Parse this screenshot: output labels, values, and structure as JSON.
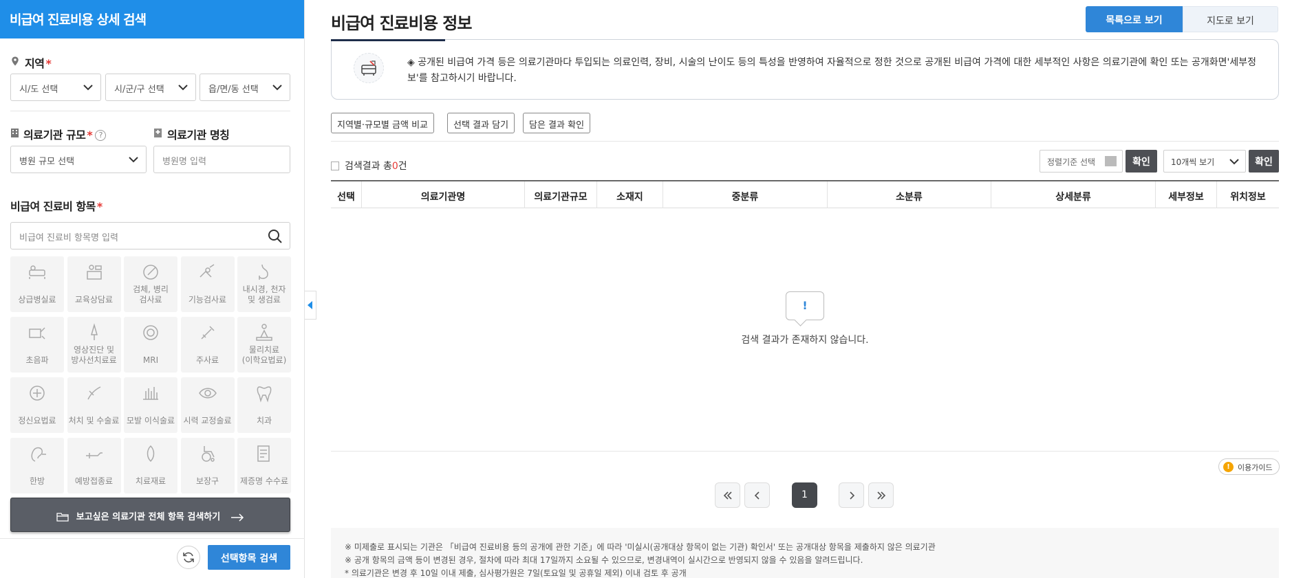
{
  "left": {
    "header": "비급여 진료비용 상세 검색",
    "region": {
      "label": "지역",
      "required": "*",
      "sido_placeholder": "시/도 선택",
      "sigungu_placeholder": "시/군/구 선택",
      "eupmyeon_placeholder": "읍/면/동 선택"
    },
    "scale": {
      "label": "의료기관 규모",
      "required": "*",
      "help": "?",
      "placeholder": "병원 규모 선택"
    },
    "name": {
      "label": "의료기관 명칭",
      "placeholder": "병원명 입력"
    },
    "item": {
      "label": "비급여 진료비 항목",
      "required": "*",
      "placeholder": "비급여 진료비 항목명 입력"
    },
    "categories": [
      [
        "상급병실료"
      ],
      [
        "교육상담료"
      ],
      [
        "검체, 병리",
        "검사료"
      ],
      [
        "기능검사료"
      ],
      [
        "내시경, 천자",
        "및 생검료"
      ],
      [
        "초음파"
      ],
      [
        "영상진단 및",
        "방사선치료료"
      ],
      [
        "MRI"
      ],
      [
        "주사료"
      ],
      [
        "물리치료",
        "(이학요법료)"
      ],
      [
        "정신요법료"
      ],
      [
        "처치 및 수술료"
      ],
      [
        "모발 이식술료"
      ],
      [
        "시력 교정술료"
      ],
      [
        "치과"
      ],
      [
        "한방"
      ],
      [
        "예방접종료"
      ],
      [
        "치료재료"
      ],
      [
        "보장구"
      ],
      [
        "제증명 수수료"
      ]
    ],
    "all_search_button": "보고싶은 의료기관 전체 항목 검색하기",
    "search_button": "선택항목 검색"
  },
  "main": {
    "title": "비급여 진료비용 정보",
    "view_list": "목록으로 보기",
    "view_map": "지도로 보기",
    "notice": "◈ 공개된 비급여 가격 등은 의료기관마다 투입되는 의료인력, 장비, 시술의 난이도 등의 특성을 반영하여 자율적으로 정한 것으로 공개된 비급여 가격에 대한 세부적인 사항은 의료기관에 확인 또는 공개화면'세부정보'를 참고하시기 바랍니다.",
    "tool_buttons": [
      "지역별·규모별 금액 비교",
      "선택 결과 담기",
      "담은 결과 확인"
    ],
    "result_prefix": "검색결과 총",
    "result_count": "0",
    "result_suffix": "건",
    "sort_placeholder": "정렬기준 선택",
    "confirm": "확인",
    "per_page": "10개씩 보기",
    "columns": [
      "선택",
      "의료기관명",
      "의료기관규모",
      "소재지",
      "중분류",
      "소분류",
      "상세분류",
      "세부정보",
      "위치정보"
    ],
    "empty_icon": "!",
    "empty_message": "검색 결과가 존재하지 않습니다.",
    "guide_icon": "!",
    "guide": "이용가이드",
    "current_page": "1",
    "notes": [
      "※ 미제출로 표시되는 기관은 「비급여 진료비용 등의 공개에 관한 기준」에 따라 '미실시(공개대상 항목이 없는 기관) 확인서' 또는 공개대상 항목을 제출하지 않은 의료기관",
      "※ 공개 항목의 금액 등이 변경된 경우, 절차에 따라 최대 17일까지 소요될 수 있으므로, 변경내역이 실시간으로 반영되지 않을 수 있음을 알려드립니다.",
      "* 의료기관은 변경 후 10일 이내 제출, 심사평가원은 7일(토요일 및 공휴일 제외) 이내 검토 후 공개"
    ]
  },
  "colors": {
    "brand_blue": "#1f8ee8",
    "button_blue": "#2f86d8",
    "required_red": "#e53935",
    "dark_button": "#4d4f54"
  },
  "icons": [
    "map-pin-icon",
    "chevron-down-icon",
    "search-icon",
    "hospital-icon",
    "refresh-icon",
    "arrow-right-icon",
    "folder-icon",
    "collapse-arrow-icon",
    "bed-icon",
    "first-page-icon",
    "prev-page-icon",
    "next-page-icon",
    "last-page-icon"
  ]
}
